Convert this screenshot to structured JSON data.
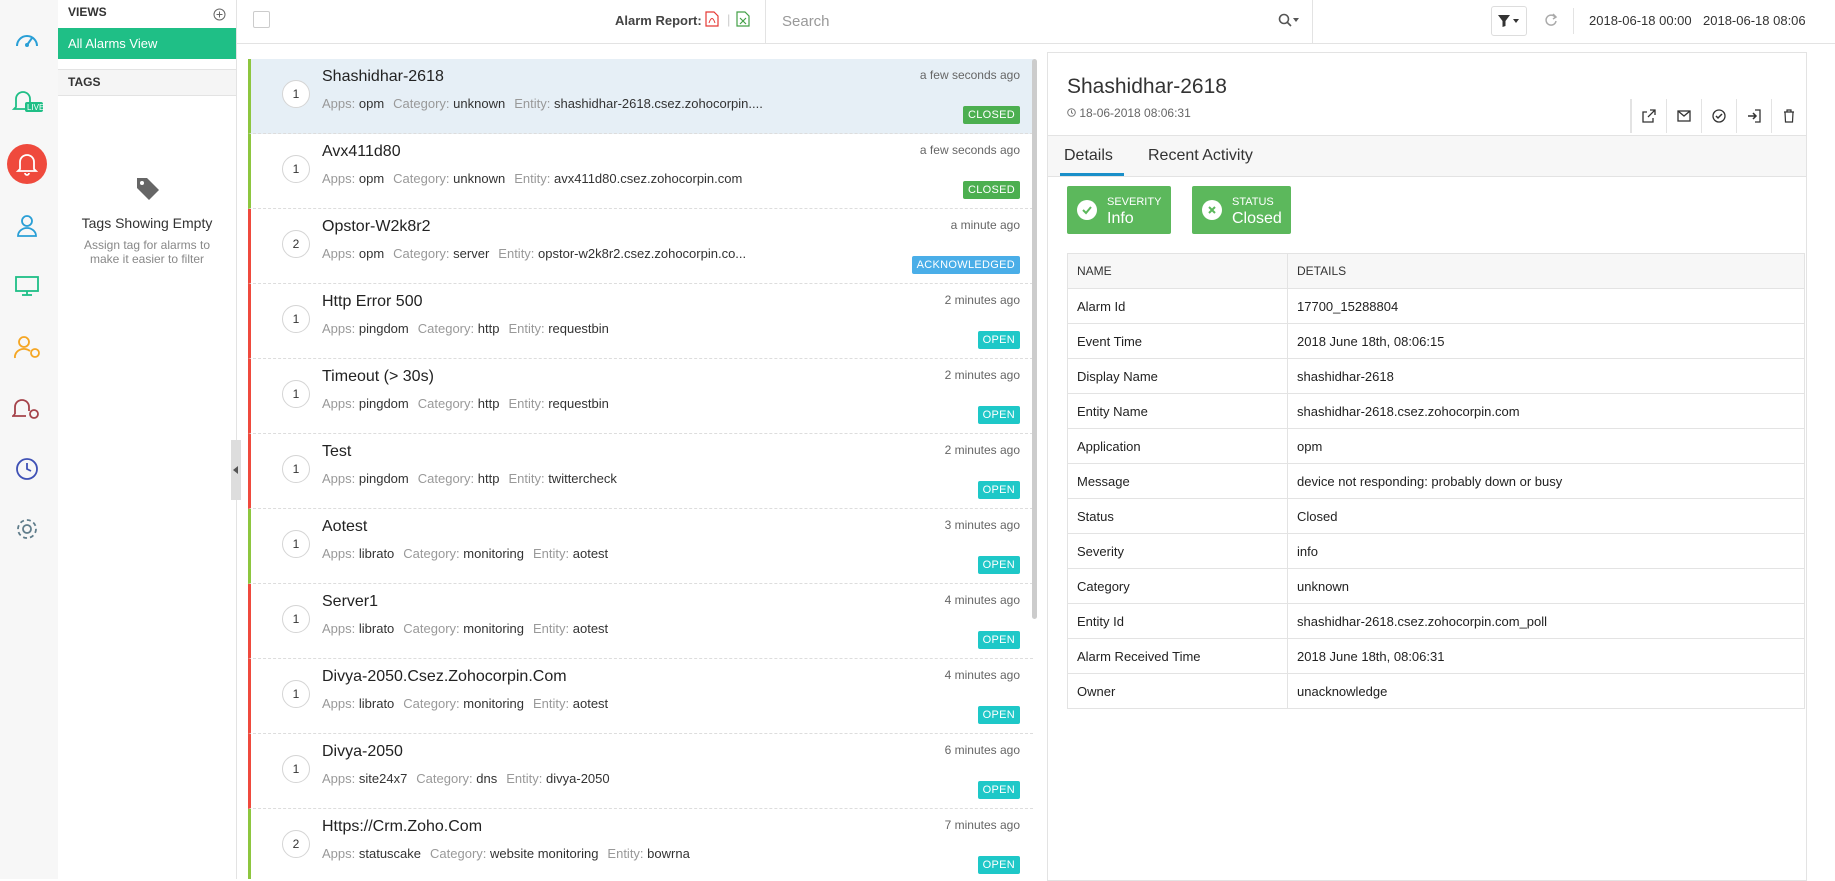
{
  "nav": {
    "icons": [
      "dashboard-icon",
      "live-icon",
      "alarm-icon",
      "user-icon",
      "monitor-icon",
      "user-settings-icon",
      "alarm-settings-icon",
      "clock-icon",
      "gear-icon"
    ]
  },
  "views": {
    "title": "VIEWS",
    "selected": "All Alarms View",
    "tags_title": "TAGS",
    "empty_title": "Tags Showing Empty",
    "empty_sub": "Assign tag for alarms to make it easier to filter"
  },
  "toolbar": {
    "report_label": "Alarm Report:",
    "search_placeholder": "Search",
    "date_from": "2018-06-18 00:00",
    "date_to": "2018-06-18 08:06"
  },
  "list_labels": {
    "apps": "Apps:",
    "category": "Category:",
    "entity": "Entity:"
  },
  "alarms": [
    {
      "count": "1",
      "name": "Shashidhar-2618",
      "apps": "opm",
      "category": "unknown",
      "entity": "shashidhar-2618.csez.zohocorpin....",
      "time": "a few seconds ago",
      "status": "CLOSED",
      "status_color": "#4caf50",
      "bar": "green",
      "selected": true
    },
    {
      "count": "1",
      "name": "Avx411d80",
      "apps": "opm",
      "category": "unknown",
      "entity": "avx411d80.csez.zohocorpin.com",
      "time": "a few seconds ago",
      "status": "CLOSED",
      "status_color": "#4caf50",
      "bar": "green"
    },
    {
      "count": "2",
      "name": "Opstor-W2k8r2",
      "apps": "opm",
      "category": "server",
      "entity": "opstor-w2k8r2.csez.zohocorpin.co...",
      "time": "a minute ago",
      "status": "ACKNOWLEDGED",
      "status_color": "#4aaee8",
      "bar": "red"
    },
    {
      "count": "1",
      "name": "Http Error 500",
      "apps": "pingdom",
      "category": "http",
      "entity": "requestbin",
      "time": "2 minutes ago",
      "status": "OPEN",
      "status_color": "#1ec8c8",
      "bar": "red"
    },
    {
      "count": "1",
      "name": "Timeout (> 30s)",
      "apps": "pingdom",
      "category": "http",
      "entity": "requestbin",
      "time": "2 minutes ago",
      "status": "OPEN",
      "status_color": "#1ec8c8",
      "bar": "red"
    },
    {
      "count": "1",
      "name": "Test",
      "apps": "pingdom",
      "category": "http",
      "entity": "twittercheck",
      "time": "2 minutes ago",
      "status": "OPEN",
      "status_color": "#1ec8c8",
      "bar": "red"
    },
    {
      "count": "1",
      "name": "Aotest",
      "apps": "librato",
      "category": "monitoring",
      "entity": "aotest",
      "time": "3 minutes ago",
      "status": "OPEN",
      "status_color": "#1ec8c8",
      "bar": "green"
    },
    {
      "count": "1",
      "name": "Server1",
      "apps": "librato",
      "category": "monitoring",
      "entity": "aotest",
      "time": "4 minutes ago",
      "status": "OPEN",
      "status_color": "#1ec8c8",
      "bar": "red"
    },
    {
      "count": "1",
      "name": "Divya-2050.Csez.Zohocorpin.Com",
      "apps": "librato",
      "category": "monitoring",
      "entity": "aotest",
      "time": "4 minutes ago",
      "status": "OPEN",
      "status_color": "#1ec8c8",
      "bar": "red"
    },
    {
      "count": "1",
      "name": "Divya-2050",
      "apps": "site24x7",
      "category": "dns",
      "entity": "divya-2050",
      "time": "6 minutes ago",
      "status": "OPEN",
      "status_color": "#1ec8c8",
      "bar": "red"
    },
    {
      "count": "2",
      "name": "Https://Crm.Zoho.Com",
      "apps": "statuscake",
      "category": "website monitoring",
      "entity": "bowrna",
      "time": "7 minutes ago",
      "status": "OPEN",
      "status_color": "#1ec8c8",
      "bar": "green"
    }
  ],
  "detail": {
    "title": "Shashidhar-2618",
    "time": "18-06-2018 08:06:31",
    "tabs": [
      "Details",
      "Recent Activity"
    ],
    "severity_label": "SEVERITY",
    "severity_value": "Info",
    "status_label": "STATUS",
    "status_value": "Closed",
    "table_headers": [
      "NAME",
      "DETAILS"
    ],
    "rows": [
      [
        "Alarm Id",
        "17700_15288804"
      ],
      [
        "Event Time",
        "2018 June 18th, 08:06:15"
      ],
      [
        "Display Name",
        "shashidhar-2618"
      ],
      [
        "Entity Name",
        "shashidhar-2618.csez.zohocorpin.com"
      ],
      [
        "Application",
        "opm"
      ],
      [
        "Message",
        "device not responding: probably down or busy"
      ],
      [
        "Status",
        "Closed"
      ],
      [
        "Severity",
        "info"
      ],
      [
        "Category",
        "unknown"
      ],
      [
        "Entity Id",
        "shashidhar-2618.csez.zohocorpin.com_poll"
      ],
      [
        "Alarm Received Time",
        "2018 June 18th, 08:06:31"
      ],
      [
        "Owner",
        "unacknowledge"
      ]
    ]
  }
}
